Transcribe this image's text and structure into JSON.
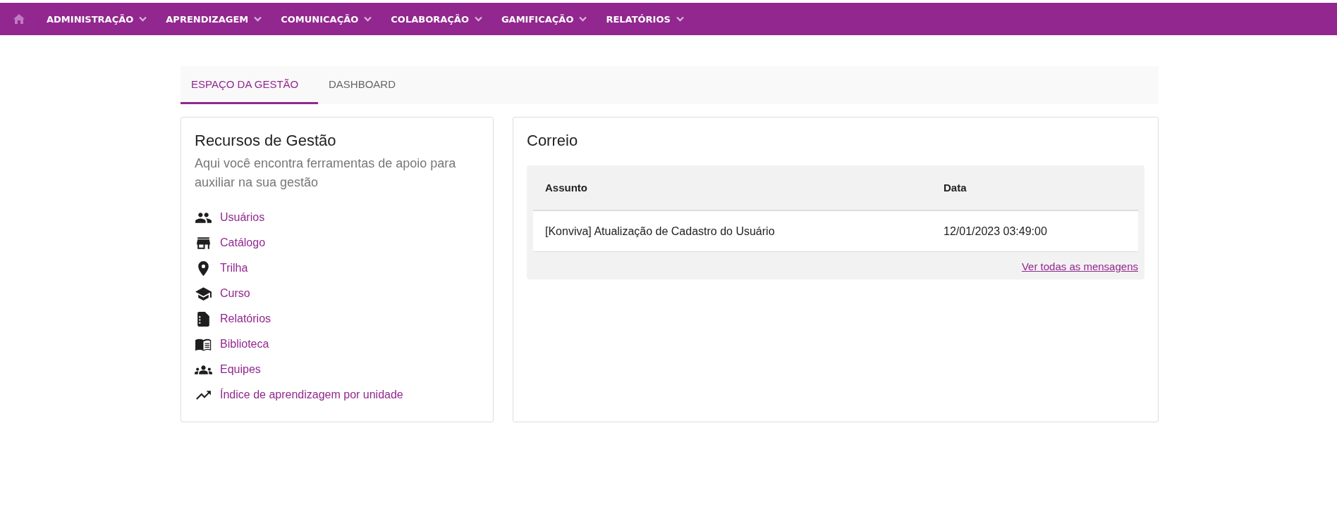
{
  "nav": {
    "items": [
      {
        "label": "ADMINISTRAÇÃO"
      },
      {
        "label": "APRENDIZAGEM"
      },
      {
        "label": "COMUNICAÇÃO"
      },
      {
        "label": "COLABORAÇÃO"
      },
      {
        "label": "GAMIFICAÇÃO"
      },
      {
        "label": "RELATÓRIOS"
      }
    ]
  },
  "tabs": [
    {
      "label": "ESPAÇO DA GESTÃO",
      "selected": true
    },
    {
      "label": "DASHBOARD",
      "selected": false
    }
  ],
  "resources": {
    "title": "Recursos de Gestão",
    "description": "Aqui você encontra ferramentas de apoio para auxiliar na sua gestão",
    "items": [
      {
        "label": "Usuários",
        "kind": "people"
      },
      {
        "label": "Catálogo",
        "kind": "store"
      },
      {
        "label": "Trilha",
        "kind": "pin"
      },
      {
        "label": "Curso",
        "kind": "school"
      },
      {
        "label": "Relatórios",
        "kind": "report"
      },
      {
        "label": "Biblioteca",
        "kind": "book"
      },
      {
        "label": "Equipes",
        "kind": "groups"
      },
      {
        "label": "Índice de aprendizagem por unidade",
        "kind": "trend"
      }
    ]
  },
  "mail": {
    "title": "Correio",
    "table": {
      "columns": [
        "Assunto",
        "Data"
      ],
      "rows": [
        [
          "[Konviva] Atualização de Cadastro do Usuário",
          "12/01/2023 03:49:00"
        ]
      ]
    },
    "link": "Ver todas as mensagens"
  }
}
